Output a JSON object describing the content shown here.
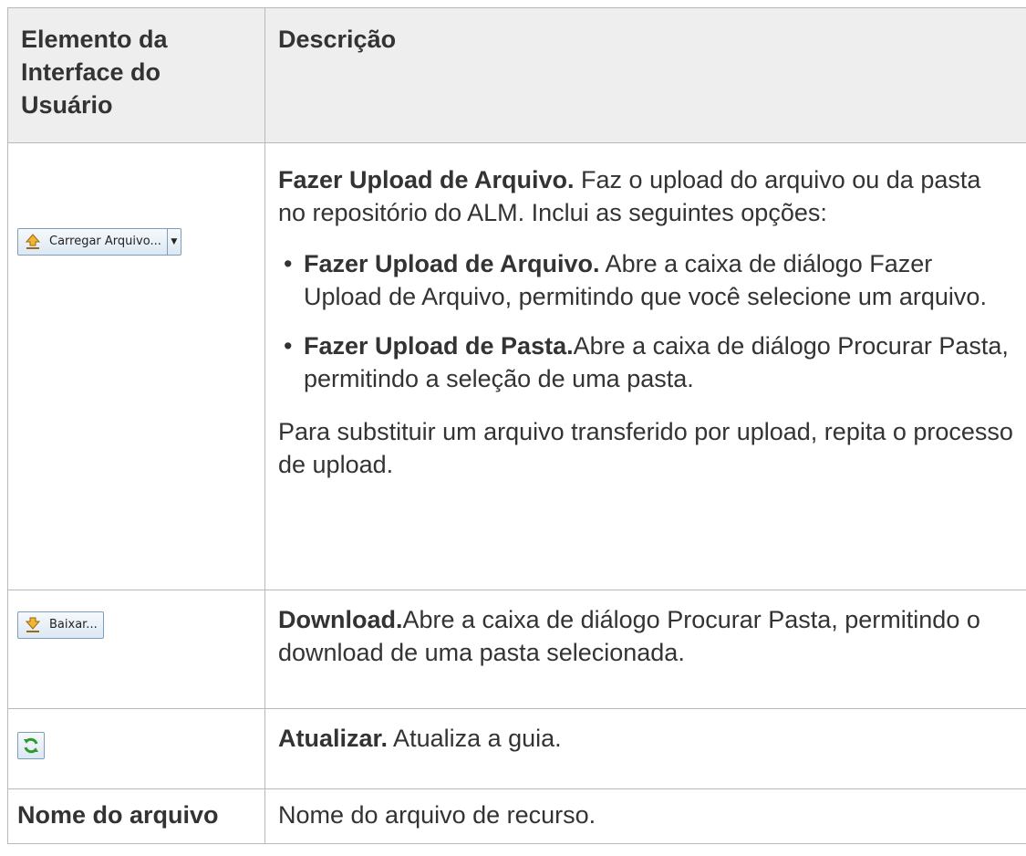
{
  "table": {
    "header": {
      "col1": "Elemento da Interface do Usuário",
      "col2": "Descrição"
    },
    "rows": [
      {
        "button": {
          "label": "Carregar Arquivo...",
          "icon": "upload-icon",
          "has_dropdown": true,
          "dropdown_icon": "dropdown-arrow-icon"
        },
        "term": "Fazer Upload de Arquivo.",
        "text": " Faz o upload do arquivo ou da pasta no repositório do ALM. Inclui as seguintes opções:",
        "options": [
          {
            "bullet": "•",
            "term": "Fazer Upload de Arquivo.",
            "text": " Abre a caixa de diálogo Fazer Upload de Arquivo, permitindo que você selecione um arquivo."
          },
          {
            "bullet": "•",
            "term": "Fazer Upload de Pasta.",
            "text": "Abre a caixa de diálogo Procurar Pasta, permitindo a seleção de uma pasta."
          }
        ],
        "after": "Para substituir um arquivo transferido por upload, repita o processo de upload."
      },
      {
        "button": {
          "label": "Baixar...",
          "icon": "download-icon"
        },
        "term": "Download.",
        "text": "Abre a caixa de diálogo Procurar Pasta, permitindo o download de uma pasta selecionada."
      },
      {
        "button": {
          "icon": "refresh-icon"
        },
        "term": "Atualizar.",
        "text": " Atualiza a guia."
      },
      {
        "element": "Nome do arquivo",
        "text": "Nome do arquivo de recurso."
      }
    ]
  }
}
